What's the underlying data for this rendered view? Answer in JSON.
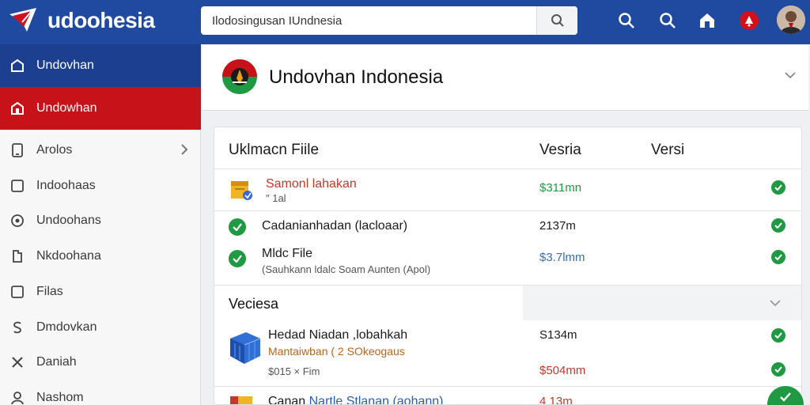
{
  "header": {
    "brand": "udoohesia",
    "search_value": "Ilodosingusan IUndnesia",
    "search_placeholder": "Ilodosingusan IUndnesia",
    "icons": [
      "search-icon",
      "search-icon",
      "home-icon",
      "notification-icon"
    ]
  },
  "sidebar": {
    "items": [
      {
        "label": "Undovhan",
        "icon": "home-icon",
        "state": "active-blue"
      },
      {
        "label": "Undowhan",
        "icon": "building-icon",
        "state": "active-red"
      },
      {
        "label": "Arolos",
        "icon": "phone-icon",
        "state": "expandable"
      },
      {
        "label": "Indoohaas",
        "icon": "square-icon",
        "state": "normal"
      },
      {
        "label": "Undoohans",
        "icon": "gear-icon",
        "state": "normal"
      },
      {
        "label": "Nkdoohana",
        "icon": "page-icon",
        "state": "normal"
      },
      {
        "label": "Filas",
        "icon": "square-icon",
        "state": "normal"
      },
      {
        "label": "Dmdovkan",
        "icon": "dollar-icon",
        "state": "normal"
      },
      {
        "label": "Daniah",
        "icon": "close-icon",
        "state": "normal"
      },
      {
        "label": "Nashom",
        "icon": "user-icon",
        "state": "normal"
      }
    ]
  },
  "main": {
    "title": "Undovhan Indonesia"
  },
  "files": {
    "headers": [
      "Uklmacn Fiile",
      "Vesria",
      "Versi"
    ],
    "rows": [
      {
        "name": "Samonl lahakan",
        "sub": "″ 1al",
        "size": "$311mn",
        "size_color": "#1f9a43"
      },
      {
        "name": "Cadanianhadan (lacloaar)",
        "sub": "",
        "size": "2137m",
        "size_color": "#1b1b1b"
      },
      {
        "name": "Mldc File",
        "sub": "(Sauhkann ldalc Soam Aunten (Apol)",
        "size": "$3.7lmm",
        "size_color": "#3a6fa8"
      }
    ],
    "section": "Veciesa",
    "section_rows": [
      {
        "name": "Hedad Niadan ,lobahkah",
        "sub1": "Mantaiwban ( 2 SOkeogaus",
        "sub2": "$015 × Fim",
        "size1": "S134m",
        "size2": "$504mm"
      },
      {
        "name_a": "Canan",
        "name_b": "Nartle Stlanan (aohann)",
        "size": "4 13m"
      }
    ]
  },
  "colors": {
    "header": "#1f4aa0",
    "sidebar_blue": "#1c3f8f",
    "sidebar_red": "#c8121a",
    "check_green": "#1f9a43"
  }
}
